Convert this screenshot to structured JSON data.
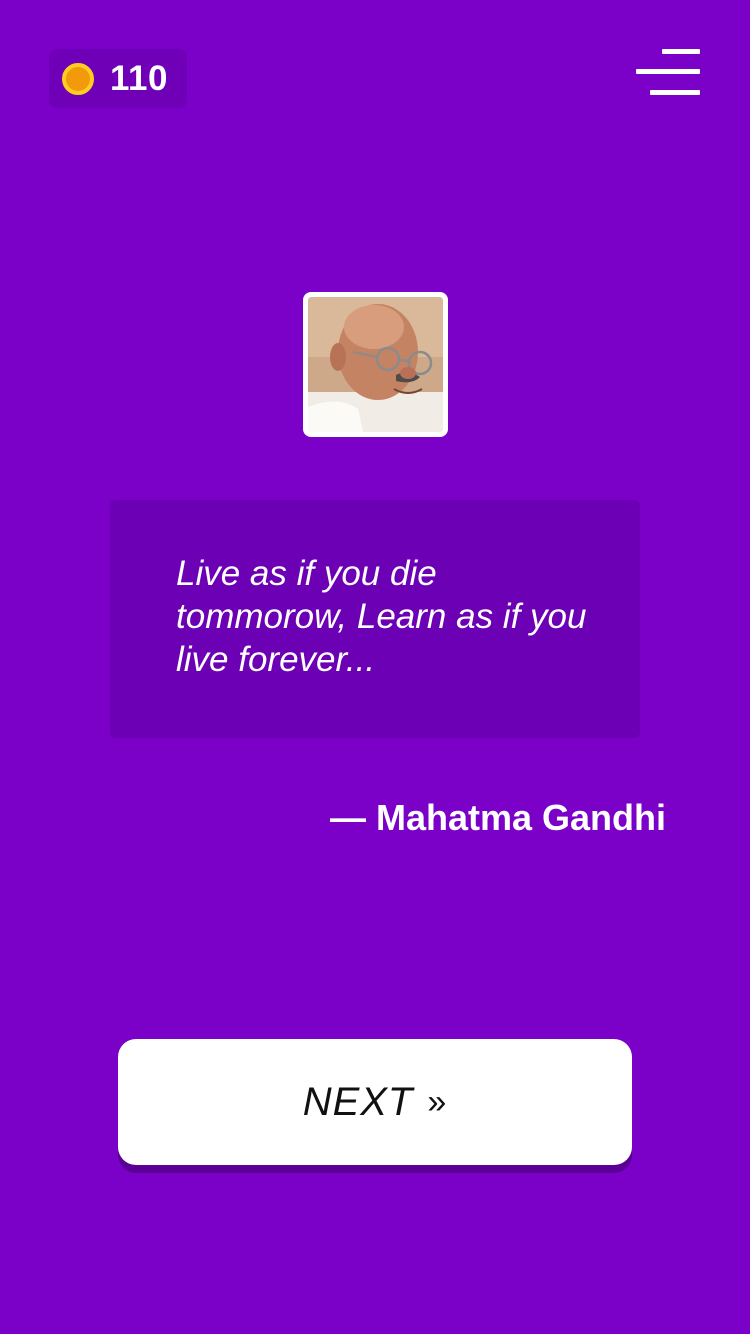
{
  "header": {
    "coins": "110",
    "coin_icon": "coin-icon",
    "menu_icon": "menu-icon"
  },
  "quote": {
    "text": "Live as if you die tommorow, Learn as if you live forever...",
    "author": "— Mahatma Gandhi",
    "portrait": "author-portrait"
  },
  "actions": {
    "next_label": "NEXT",
    "next_icon_glyph": "»",
    "next_icon": "double-chevron-right-icon"
  },
  "colors": {
    "background": "#7b00c8",
    "quote_box": "#6c00b5",
    "coin_outer": "#ffcf1f",
    "coin_inner": "#f29a0c",
    "button": "#ffffff"
  }
}
